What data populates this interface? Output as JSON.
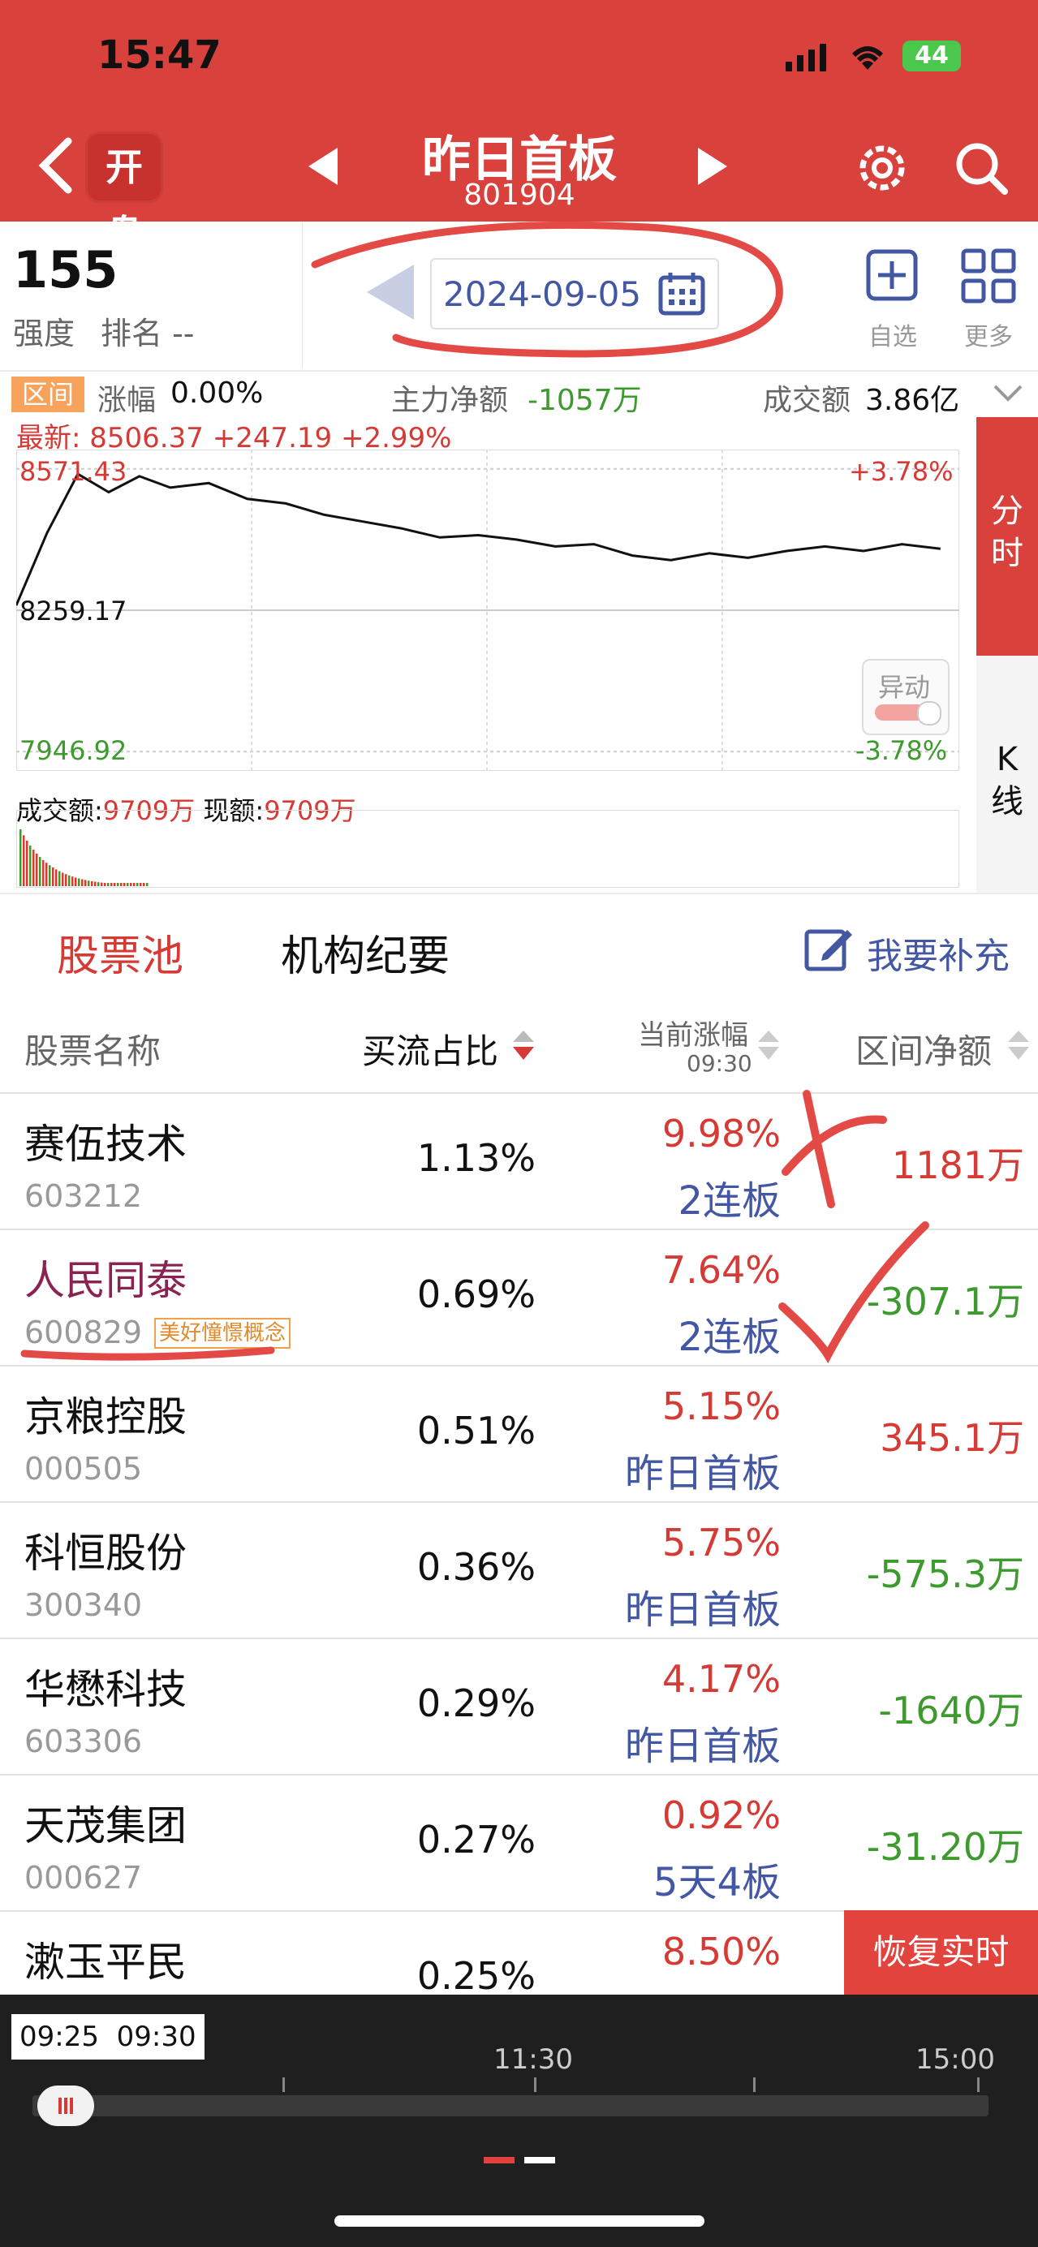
{
  "status_bar": {
    "time": "15:47",
    "battery": "44"
  },
  "header": {
    "open_badge": "开盘",
    "title": "昨日首板",
    "code": "801904"
  },
  "summary": {
    "strength_value": "155",
    "strength_label": "强度",
    "rank_label": "排名 --",
    "date": "2024-09-05",
    "add_watch": "自选",
    "more": "更多",
    "interval_badge": "区间",
    "change_label": "涨幅",
    "change_value": "0.00%",
    "main_net_label": "主力净额",
    "main_net_value": "-1057万",
    "turnover_label": "成交额",
    "turnover_value": "3.86亿"
  },
  "chart_header": {
    "latest_label": "最新:",
    "latest_value": "8506.37",
    "change": "+247.19",
    "change_pct": "+2.99%"
  },
  "chart_data": {
    "type": "line",
    "y_axis_left": [
      "8571.43",
      "8259.17",
      "7946.92"
    ],
    "y_axis_right": [
      "+3.78%",
      "-3.78%"
    ],
    "ylim": [
      7946.92,
      8571.43
    ],
    "x": [
      0,
      4,
      8,
      12,
      16,
      20,
      25,
      30,
      35,
      40,
      45,
      50,
      55,
      60,
      65,
      70,
      75,
      80,
      85,
      90,
      95,
      100,
      105,
      110,
      115,
      120
    ],
    "values": [
      8270,
      8430,
      8560,
      8520,
      8555,
      8530,
      8540,
      8505,
      8495,
      8470,
      8455,
      8440,
      8420,
      8425,
      8415,
      8400,
      8405,
      8380,
      8370,
      8385,
      8375,
      8390,
      8400,
      8390,
      8405,
      8395
    ],
    "volume_label": "成交额:",
    "volume_value": "9709万",
    "current_label": "现额:",
    "current_value": "9709万",
    "alert_label": "异动",
    "tab_time": "分时",
    "tab_k": "K线"
  },
  "tabs": {
    "pool": "股票池",
    "institution": "机构纪要",
    "supplement": "我要补充"
  },
  "table_header": {
    "name": "股票名称",
    "ratio": "买流占比",
    "cur_pct": "当前涨幅",
    "cur_time": "09:30",
    "net": "区间净额"
  },
  "rows": [
    {
      "name": "赛伍技术",
      "code": "603212",
      "ratio": "1.13%",
      "pct": "9.98%",
      "tag": "2连板",
      "net": "1181万",
      "net_color": "#d63a35"
    },
    {
      "name": "人民同泰",
      "code": "600829",
      "concept": "美好憧憬概念",
      "ratio": "0.69%",
      "pct": "7.64%",
      "tag": "2连板",
      "net": "-307.1万",
      "net_color": "#3e9a2f"
    },
    {
      "name": "京粮控股",
      "code": "000505",
      "ratio": "0.51%",
      "pct": "5.15%",
      "tag": "昨日首板",
      "net": "345.1万",
      "net_color": "#d63a35"
    },
    {
      "name": "科恒股份",
      "code": "300340",
      "ratio": "0.36%",
      "pct": "5.75%",
      "tag": "昨日首板",
      "net": "-575.3万",
      "net_color": "#3e9a2f"
    },
    {
      "name": "华懋科技",
      "code": "603306",
      "ratio": "0.29%",
      "pct": "4.17%",
      "tag": "昨日首板",
      "net": "-1640万",
      "net_color": "#3e9a2f"
    },
    {
      "name": "天茂集团",
      "code": "000627",
      "ratio": "0.27%",
      "pct": "0.92%",
      "tag": "5天4板",
      "net": "-31.20万",
      "net_color": "#3e9a2f"
    },
    {
      "name": "漱玉平民",
      "code": "",
      "ratio": "0.25%",
      "pct": "8.50%",
      "tag": "",
      "net": "",
      "net_color": "#3e9a2f"
    }
  ],
  "restore_button": "恢复实时",
  "timeline": {
    "range": "09:25  09:30",
    "mid": "11:30",
    "end": "15:00"
  }
}
